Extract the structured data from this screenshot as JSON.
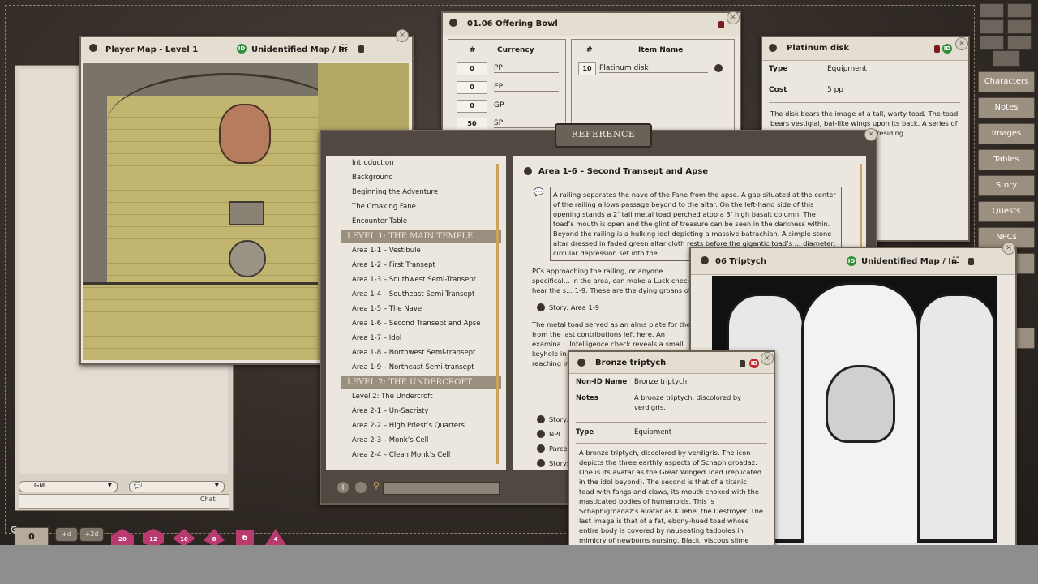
{
  "player_map": {
    "title": "Player Map - Level 1",
    "id_label": "Unidentified Map / In"
  },
  "offering_bowl": {
    "title": "01.06 Offering Bowl",
    "currency_hash": "#",
    "currency_header": "Currency",
    "currencies": [
      {
        "qty": "0",
        "name": "PP"
      },
      {
        "qty": "0",
        "name": "EP"
      },
      {
        "qty": "0",
        "name": "GP"
      },
      {
        "qty": "50",
        "name": "SP"
      }
    ],
    "item_hash": "#",
    "item_header": "Item Name",
    "items": [
      {
        "qty": "10",
        "name": "Platinum disk"
      }
    ]
  },
  "platinum_disk": {
    "title": "Platinum disk",
    "type_label": "Type",
    "type_value": "Equipment",
    "cost_label": "Cost",
    "cost_value": "5 pp",
    "description": "The disk bears the image of a tall, warty toad. The toad bears vestigial, bat-like wings upon its back. A series of ... hang from its ... pair of each residing"
  },
  "sidebar": {
    "buttons": [
      "Characters",
      "Notes",
      "Images",
      "Tables",
      "Story",
      "Quests",
      "NPCs"
    ]
  },
  "reference": {
    "title": "REFERENCE",
    "toc_top": [
      "Introduction",
      "Background",
      "Beginning the Adventure",
      "The Croaking Fane",
      "Encounter Table"
    ],
    "section1": "LEVEL 1: THE MAIN TEMPLE",
    "toc_level1": [
      "Area 1-1 – Vestibule",
      "Area 1-2 – First Transept",
      "Area 1-3 – Southwest Semi-Transept",
      "Area 1-4 – Southeast Semi-Transept",
      "Area 1-5 – The Nave",
      "Area 1-6 – Second Transept and Apse",
      "Area 1-7 – Idol",
      "Area 1-8 – Northwest Semi-transept",
      "Area 1-9 – Northeast Semi-transept"
    ],
    "section2": "LEVEL 2: THE UNDERCROFT",
    "toc_level2": [
      "Level 2: The Undercroft",
      "Area 2-1 – Un-Sacristy",
      "Area 2-2 – High Priest’s Quarters",
      "Area 2-3 – Monk’s Cell",
      "Area 2-4 – Clean Monk’s Cell"
    ],
    "content_title": "Area 1-6 – Second Transept and Apse",
    "boxed_text": "A railing separates the nave of the Fane from the apse. A gap situated at the center of the railing allows passage beyond to the altar. On the left-hand side of this opening stands a 2’ tall metal toad perched atop a 3’ high basalt column. The toad’s mouth is open and the glint of treasure can be seen in the darkness within. Beyond the railing is a hulking idol depicting a massive batrachian. A simple stone altar dressed in faded green altar cloth rests before the gigantic toad’s ... diameter, circular depression set into the ...",
    "para1": "PCs approaching the railing, or anyone specifical... in the area, can make a Luck check to hear the s... 1-9. These are the dying groans of Irrek the infe...",
    "story_link": "Story: Area 1-9",
    "para2": "The metal toad served as an alms plate for the F... from the last contributions left here. An examina... Intelligence check reveals a small keyhole in the ... proper key ... circumvent ... reaching in ... requiring a ... and 10 plati... each.",
    "links": [
      "Story:",
      "NPC:",
      "Parce",
      "Story:"
    ]
  },
  "triptych_map": {
    "title": "06 Triptych",
    "id_label": "Unidentified Map / In"
  },
  "bronze_triptych": {
    "title": "Bronze triptych",
    "nonid_label": "Non-ID Name",
    "nonid_value": "Bronze triptych",
    "notes_label": "Notes",
    "notes_value": "A bronze triptych, discolored by verdigris.",
    "type_label": "Type",
    "type_value": "Equipment",
    "description": "A bronze triptych, discolored by verdigris. The icon depicts the three earthly aspects of Schaphigroadaz. One is its avatar as the Great Winged Toad (replicated in the idol beyond). The second is that of a titanic toad with fangs and claws, its mouth choked with the masticated bodies of humanoids. This is Schaphigroadaz’s avatar as K’Tehe, the Destroyer. The last image is that of a fat, ebony-hued toad whose entire body is covered by nauseating tadpoles in mimicry of newborns nursing. Black, viscous slime oozes from the toad’s mouth in"
  },
  "chat": {
    "identity": "GM",
    "chat_button": "Chat"
  },
  "dice_bar": {
    "modifier": "0",
    "mod_buttons": [
      "+d",
      "+2d"
    ],
    "dice": [
      "20",
      "12",
      "10",
      "8",
      "6",
      "4"
    ]
  },
  "colors": {
    "parchment": "#ece7de",
    "frame": "#6b6154",
    "section_band": "#9a8f7f",
    "id_badge": "#2f8f3a",
    "dice": "#b93a6e"
  }
}
